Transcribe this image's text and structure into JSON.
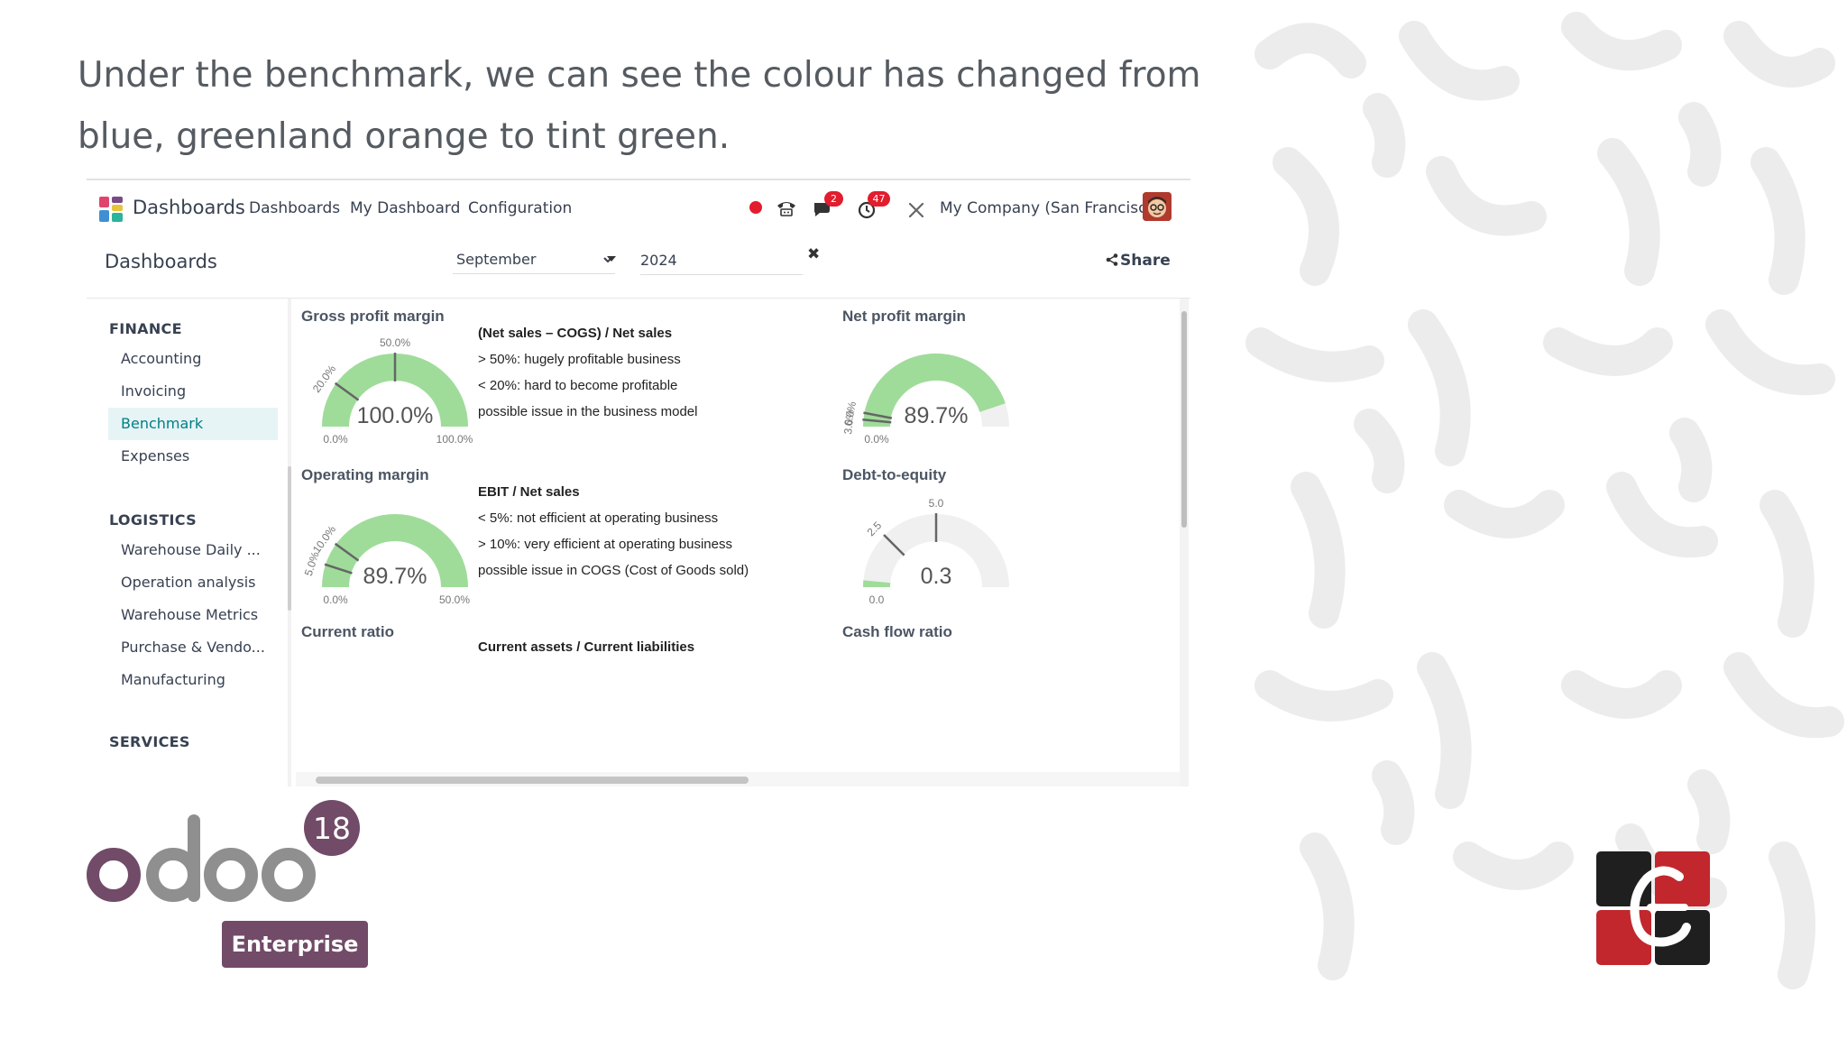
{
  "caption": {
    "line1": "Under the benchmark, we can see the colour has changed from",
    "line2": "blue, greenland orange to tint green."
  },
  "navbar": {
    "app_name": "Dashboards",
    "menu": [
      "Dashboards",
      "My Dashboard",
      "Configuration"
    ],
    "messages_badge": "2",
    "activities_badge": "47",
    "company": "My Company (San Francisco)"
  },
  "controlbar": {
    "title": "Dashboards",
    "month": "September",
    "month_options": [
      "September"
    ],
    "year": "2024",
    "clear": "✖",
    "share_label": "Share"
  },
  "sidebar": {
    "sections": [
      {
        "title": "FINANCE",
        "items": [
          "Accounting",
          "Invoicing",
          "Benchmark",
          "Expenses"
        ]
      },
      {
        "title": "LOGISTICS",
        "items": [
          "Warehouse Daily ...",
          "Operation analysis",
          "Warehouse Metrics",
          "Purchase & Vendo...",
          "Manufacturing"
        ]
      },
      {
        "title": "SERVICES",
        "items": []
      }
    ],
    "active_item": "Benchmark"
  },
  "cards": {
    "gross": {
      "title": "Gross profit margin",
      "value_label": "100.0%",
      "min_label": "0.0%",
      "max_label": "100.0%",
      "ticks": [
        "50.0%",
        "20.0%"
      ],
      "value": 100,
      "min": 0,
      "max": 100,
      "tick_values": [
        50,
        20
      ]
    },
    "gross_desc": {
      "heading": "(Net sales – COGS) / Net sales",
      "lines": [
        "> 50%: hugely profitable business",
        "< 20%: hard to become profitable",
        "possible issue in the business model"
      ]
    },
    "net": {
      "title": "Net profit margin",
      "value_label": "89.7%",
      "min_label": "0.0%",
      "ticks": [
        "6.0%",
        "3.0%"
      ],
      "value": 89.7,
      "min": 0,
      "max": 100,
      "tick_values": [
        6,
        3
      ]
    },
    "operating": {
      "title": "Operating margin",
      "value_label": "89.7%",
      "min_label": "0.0%",
      "max_label": "50.0%",
      "ticks": [
        "10.0%",
        "5.0%"
      ],
      "value": 89.7,
      "min": 0,
      "max": 50,
      "tick_values": [
        10,
        5
      ]
    },
    "operating_desc": {
      "heading": "EBIT / Net sales",
      "lines": [
        "< 5%: not efficient at operating business",
        "> 10%: very efficient at operating business",
        "possible issue in COGS (Cost of Goods sold)"
      ]
    },
    "debt": {
      "title": "Debt-to-equity",
      "value_label": "0.3",
      "min_label": "0.0",
      "ticks": [
        "5.0",
        "2.5"
      ],
      "value": 0.3,
      "min": 0,
      "max": 10,
      "tick_values": [
        5,
        2.5
      ]
    },
    "current": {
      "title": "Current ratio"
    },
    "current_desc": {
      "heading": "Current assets / Current liabilities"
    },
    "cash": {
      "title": "Cash flow ratio"
    }
  },
  "colors": {
    "gauge_fill": "#9fdc9a",
    "gauge_track": "#f0f0f0",
    "accent": "#017e84",
    "odoo_purple": "#714b67",
    "odoo_grey": "#8f8f8f"
  },
  "branding": {
    "odoo_version": "18",
    "edition": "Enterprise"
  }
}
